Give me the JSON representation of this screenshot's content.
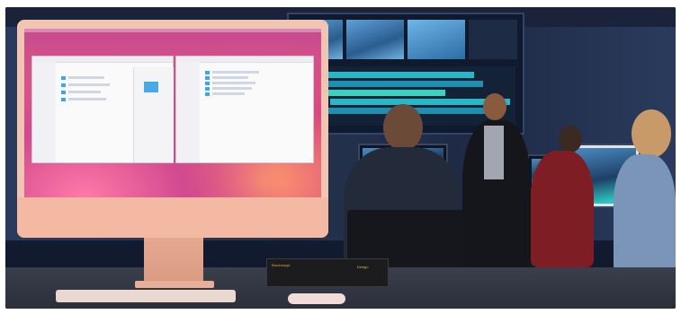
{
  "scene": {
    "description_alt": "",
    "device_label_line1": "Blackmagic",
    "device_label_line2": "Design"
  },
  "colors": {
    "imac_body": "#f2c4b2",
    "wallpaper_pink": "#d24a8f",
    "timeline_cyan": "#28b7c7",
    "room_blue": "#25334f"
  },
  "icons": [
    "finder-window-icon",
    "folder-icon",
    "apple-logo-icon"
  ]
}
